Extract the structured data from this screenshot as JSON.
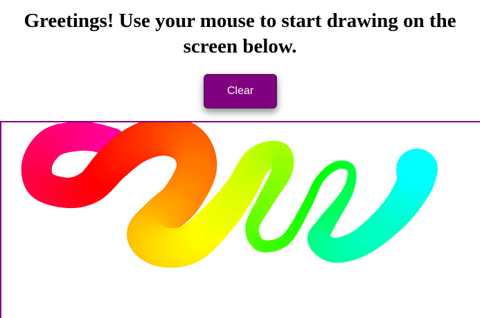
{
  "heading": {
    "text": "Greetings! Use your mouse to start drawing on the screen below."
  },
  "toolbar": {
    "clear_label": "Clear"
  },
  "colors": {
    "button_bg": "#800080",
    "button_text": "#ffffff",
    "canvas_border": "#800080",
    "stroke_start": "#ff00b4",
    "stroke_red": "#ff0a28",
    "stroke_orange": "#ff8a1a",
    "stroke_yellow": "#ffff2a",
    "stroke_green": "#00ff30",
    "stroke_end": "#00ffff"
  }
}
